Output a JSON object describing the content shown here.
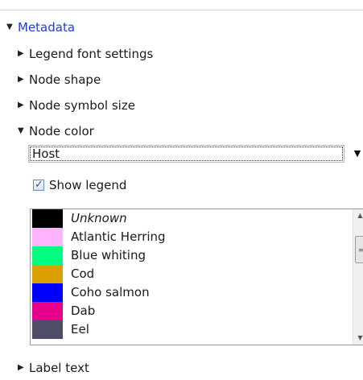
{
  "tree": {
    "metadata": "Metadata",
    "legend_font_settings": "Legend font settings",
    "node_shape": "Node shape",
    "node_symbol_size": "Node symbol size",
    "node_color": "Node color",
    "label_text": "Label text"
  },
  "node_color": {
    "selected": "Host",
    "show_legend_label": "Show legend",
    "show_legend_checked": true
  },
  "legend_items": [
    {
      "label": "Unknown",
      "color": "#000000",
      "italic": true
    },
    {
      "label": "Atlantic Herring",
      "color": "#ffb3ff"
    },
    {
      "label": "Blue whiting",
      "color": "#00ff80"
    },
    {
      "label": "Cod",
      "color": "#d9a000"
    },
    {
      "label": "Coho salmon",
      "color": "#0000ff"
    },
    {
      "label": "Dab",
      "color": "#e6008c"
    },
    {
      "label": "Eel",
      "color": "#4d4d66"
    }
  ],
  "icons": {
    "expanded": "triangle-down-icon",
    "collapsed": "triangle-right-icon",
    "dropdown": "dropdown-arrow-icon",
    "checkmark": "checkmark-icon"
  }
}
